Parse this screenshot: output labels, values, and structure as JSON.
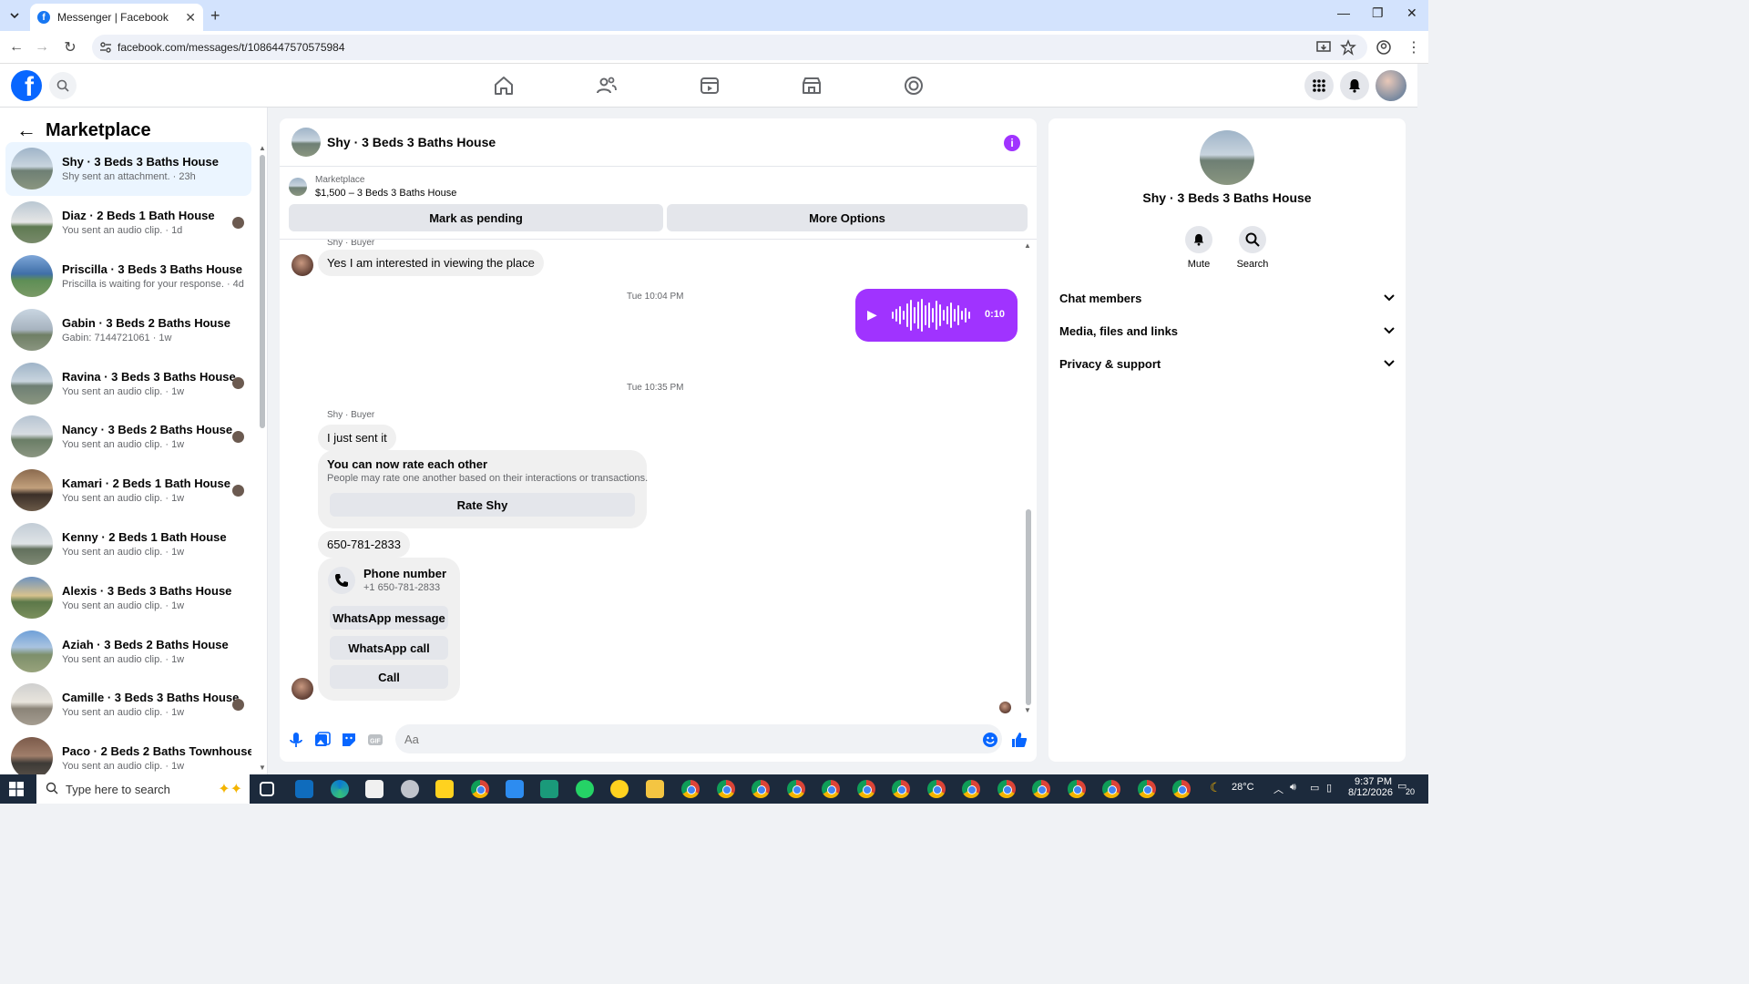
{
  "browser": {
    "tab_title": "Messenger | Facebook",
    "url": "facebook.com/messages/t/1086447570575984"
  },
  "sidebar": {
    "title": "Marketplace",
    "conversations": [
      {
        "name": "Shy · 3 Beds 3 Baths House",
        "preview": "Shy sent an attachment. · 23h",
        "active": true
      },
      {
        "name": "Diaz · 2 Beds 1 Bath House",
        "preview": "You sent an audio clip. · 1d",
        "seen": true
      },
      {
        "name": "Priscilla · 3 Beds 3 Baths House",
        "preview": "Priscilla is waiting for your response. · 4d"
      },
      {
        "name": "Gabin · 3 Beds 2 Baths House",
        "preview": "Gabin: 7144721061 · 1w"
      },
      {
        "name": "Ravina · 3 Beds 3 Baths House",
        "preview": "You sent an audio clip. · 1w",
        "seen": true
      },
      {
        "name": "Nancy · 3 Beds 2 Baths House",
        "preview": "You sent an audio clip. · 1w",
        "seen": true
      },
      {
        "name": "Kamari · 2 Beds 1 Bath House",
        "preview": "You sent an audio clip. · 1w",
        "seen": true
      },
      {
        "name": "Kenny · 2 Beds 1 Bath House",
        "preview": "You sent an audio clip. · 1w"
      },
      {
        "name": "Alexis · 3 Beds 3 Baths House",
        "preview": "You sent an audio clip. · 1w"
      },
      {
        "name": "Aziah · 3 Beds 2 Baths House",
        "preview": "You sent an audio clip. · 1w"
      },
      {
        "name": "Camille · 3 Beds 3 Baths House",
        "preview": "You sent an audio clip. · 1w",
        "seen": true
      },
      {
        "name": "Paco · 2 Beds 2 Baths Townhouse",
        "preview": "You sent an audio clip. · 1w"
      }
    ]
  },
  "chat": {
    "header_title": "Shy · 3 Beds 3 Baths House",
    "listing_source": "Marketplace",
    "listing_title": "$1,500 – 3 Beds 3 Baths House",
    "mark_pending": "Mark as pending",
    "more_options": "More Options",
    "sender_label": "Shy · Buyer",
    "msg1": "Yes I am interested in viewing the place",
    "time1": "Tue 10:04 PM",
    "audio_duration": "0:10",
    "time2": "Tue 10:35 PM",
    "sender_label2": "Shy · Buyer",
    "msg2": "I just sent it",
    "rate_title": "You can now rate each other",
    "rate_desc": "People may rate one another based on their interactions or transactions.",
    "rate_button": "Rate Shy",
    "msg3": "650-781-2833",
    "phone_title": "Phone number",
    "phone_value": "+1 650-781-2833",
    "whatsapp_message": "WhatsApp message",
    "whatsapp_call": "WhatsApp call",
    "call": "Call",
    "composer_placeholder": "Aa"
  },
  "details": {
    "name": "Shy · 3 Beds 3 Baths House",
    "mute": "Mute",
    "search": "Search",
    "sections": [
      "Chat members",
      "Media, files and links",
      "Privacy & support"
    ]
  },
  "taskbar": {
    "search_placeholder": "Type here to search",
    "weather": "28°C",
    "time": "9:37 PM",
    "date": "8/12/2026",
    "notifications": "20"
  },
  "colors": {
    "accent": "#a033ff",
    "fb_blue": "#0866ff",
    "active_row": "#ebf5ff"
  }
}
